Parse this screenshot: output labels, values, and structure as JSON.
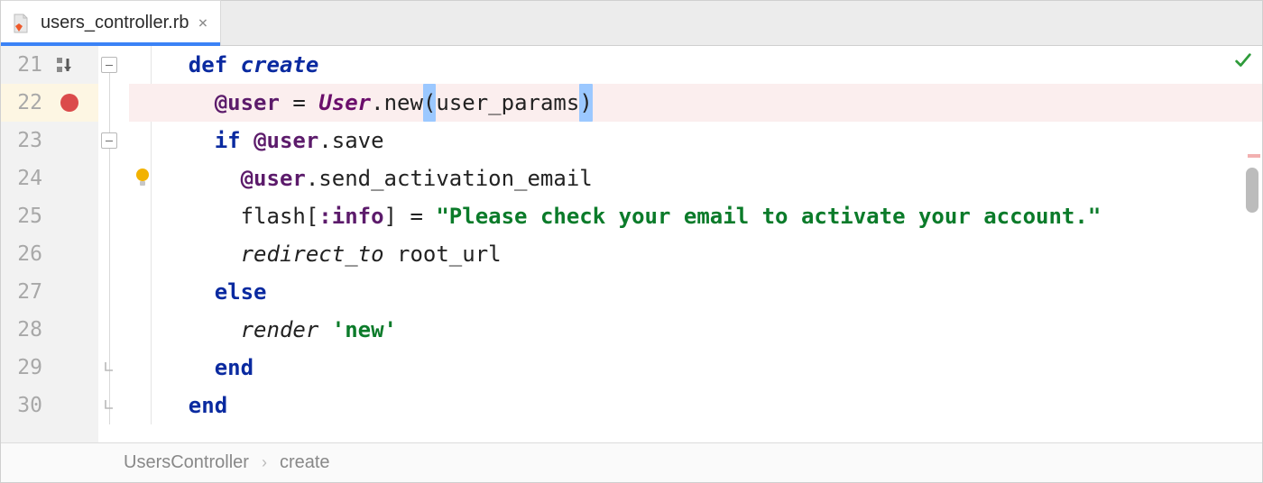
{
  "tab": {
    "filename": "users_controller.rb"
  },
  "gutter": {
    "lines": [
      "21",
      "22",
      "23",
      "24",
      "25",
      "26",
      "27",
      "28",
      "29",
      "30"
    ],
    "breakpoint_line_index": 1
  },
  "code": {
    "l21": {
      "indent": "    ",
      "kw_def": "def",
      "sp": " ",
      "mname": "create"
    },
    "l22": {
      "indent": "      ",
      "ivar": "@user",
      "eq": " = ",
      "const": "User",
      "dot": ".",
      "new": "new",
      "lp": "(",
      "args": "user_params",
      "rp": ")"
    },
    "l23": {
      "indent": "      ",
      "kw_if": "if",
      "sp": " ",
      "ivar": "@user",
      "dot": ".",
      "call": "save"
    },
    "l24": {
      "indent": "        ",
      "ivar": "@user",
      "dot": ".",
      "call": "send_activation_email"
    },
    "l25": {
      "indent": "        ",
      "flash": "flash",
      "lb": "[",
      "sym": ":info",
      "rb": "]",
      "eq": " = ",
      "str": "\"Please check your email to activate your account.\""
    },
    "l26": {
      "indent": "        ",
      "call": "redirect_to",
      "sp": " ",
      "arg": "root_url"
    },
    "l27": {
      "indent": "      ",
      "kw": "else"
    },
    "l28": {
      "indent": "        ",
      "call": "render",
      "sp": " ",
      "str": "'new'"
    },
    "l29": {
      "indent": "      ",
      "kw": "end"
    },
    "l30": {
      "indent": "    ",
      "kw": "end"
    }
  },
  "breadcrumbs": {
    "controller": "UsersController",
    "action": "create"
  }
}
